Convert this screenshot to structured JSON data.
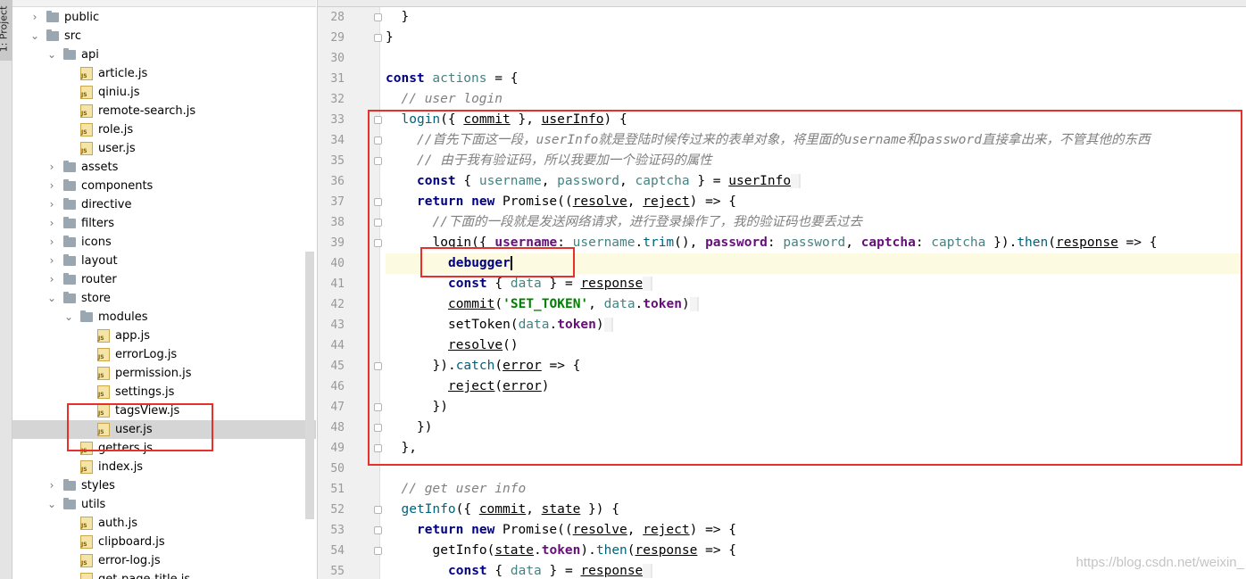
{
  "sidebar_tab": {
    "label": "1: Project"
  },
  "tree": [
    {
      "name": "public",
      "type": "folder",
      "depth": 1,
      "expanded": false
    },
    {
      "name": "src",
      "type": "folder",
      "depth": 1,
      "expanded": true
    },
    {
      "name": "api",
      "type": "folder",
      "depth": 2,
      "expanded": true
    },
    {
      "name": "article.js",
      "type": "file",
      "depth": 3
    },
    {
      "name": "qiniu.js",
      "type": "file",
      "depth": 3
    },
    {
      "name": "remote-search.js",
      "type": "file",
      "depth": 3
    },
    {
      "name": "role.js",
      "type": "file",
      "depth": 3
    },
    {
      "name": "user.js",
      "type": "file",
      "depth": 3
    },
    {
      "name": "assets",
      "type": "folder",
      "depth": 2,
      "expanded": false
    },
    {
      "name": "components",
      "type": "folder",
      "depth": 2,
      "expanded": false
    },
    {
      "name": "directive",
      "type": "folder",
      "depth": 2,
      "expanded": false
    },
    {
      "name": "filters",
      "type": "folder",
      "depth": 2,
      "expanded": false
    },
    {
      "name": "icons",
      "type": "folder",
      "depth": 2,
      "expanded": false
    },
    {
      "name": "layout",
      "type": "folder",
      "depth": 2,
      "expanded": false
    },
    {
      "name": "router",
      "type": "folder",
      "depth": 2,
      "expanded": false
    },
    {
      "name": "store",
      "type": "folder",
      "depth": 2,
      "expanded": true
    },
    {
      "name": "modules",
      "type": "folder",
      "depth": 3,
      "expanded": true
    },
    {
      "name": "app.js",
      "type": "file",
      "depth": 4
    },
    {
      "name": "errorLog.js",
      "type": "file",
      "depth": 4
    },
    {
      "name": "permission.js",
      "type": "file",
      "depth": 4
    },
    {
      "name": "settings.js",
      "type": "file",
      "depth": 4
    },
    {
      "name": "tagsView.js",
      "type": "file",
      "depth": 4
    },
    {
      "name": "user.js",
      "type": "file",
      "depth": 4,
      "selected": true
    },
    {
      "name": "getters.js",
      "type": "file",
      "depth": 3
    },
    {
      "name": "index.js",
      "type": "file",
      "depth": 3
    },
    {
      "name": "styles",
      "type": "folder",
      "depth": 2,
      "expanded": false
    },
    {
      "name": "utils",
      "type": "folder",
      "depth": 2,
      "expanded": true
    },
    {
      "name": "auth.js",
      "type": "file",
      "depth": 3
    },
    {
      "name": "clipboard.js",
      "type": "file",
      "depth": 3
    },
    {
      "name": "error-log.js",
      "type": "file",
      "depth": 3
    },
    {
      "name": "get-page-title.js",
      "type": "file",
      "depth": 3
    }
  ],
  "editor": {
    "current_line": 40,
    "lines": [
      {
        "n": "28",
        "fold": true,
        "indent": 1,
        "tokens": [
          [
            "p",
            "}"
          ]
        ]
      },
      {
        "n": "29",
        "fold": true,
        "indent": 0,
        "tokens": [
          [
            "p",
            "}"
          ]
        ]
      },
      {
        "n": "30",
        "indent": 0,
        "tokens": []
      },
      {
        "n": "31",
        "indent": 0,
        "tokens": [
          [
            "kw",
            "const"
          ],
          [
            "p",
            " "
          ],
          [
            "var",
            "actions"
          ],
          [
            "p",
            " = {"
          ]
        ]
      },
      {
        "n": "32",
        "indent": 1,
        "tokens": [
          [
            "cmt",
            "// user login"
          ]
        ]
      },
      {
        "n": "33",
        "fold": true,
        "indent": 1,
        "tokens": [
          [
            "fn",
            "login"
          ],
          [
            "p",
            "({ "
          ],
          [
            "param",
            "commit"
          ],
          [
            "p",
            " }, "
          ],
          [
            "param",
            "userInfo"
          ],
          [
            "p",
            ") {"
          ]
        ]
      },
      {
        "n": "34",
        "fold": true,
        "indent": 2,
        "tokens": [
          [
            "cmt",
            "//首先下面这一段，userInfo就是登陆时候传过来的表单对象，将里面的username和password直接拿出来，不管其他的东西"
          ]
        ]
      },
      {
        "n": "35",
        "fold": true,
        "indent": 2,
        "tokens": [
          [
            "cmt",
            "// 由于我有验证码，所以我要加一个验证码的属性"
          ]
        ]
      },
      {
        "n": "36",
        "indent": 2,
        "tokens": [
          [
            "kw",
            "const"
          ],
          [
            "p",
            " { "
          ],
          [
            "var",
            "username"
          ],
          [
            "p",
            ", "
          ],
          [
            "var",
            "password"
          ],
          [
            "p",
            ", "
          ],
          [
            "var",
            "captcha"
          ],
          [
            "p",
            " } = "
          ],
          [
            "param",
            "userInfo"
          ],
          [
            "hl",
            ""
          ]
        ]
      },
      {
        "n": "37",
        "fold": true,
        "indent": 2,
        "tokens": [
          [
            "kw",
            "return"
          ],
          [
            "p",
            " "
          ],
          [
            "kw",
            "new"
          ],
          [
            "p",
            " Promise(("
          ],
          [
            "param",
            "resolve"
          ],
          [
            "p",
            ", "
          ],
          [
            "param",
            "reject"
          ],
          [
            "p",
            ") => {"
          ]
        ]
      },
      {
        "n": "38",
        "fold": true,
        "indent": 3,
        "tokens": [
          [
            "cmt",
            "//下面的一段就是发送网络请求，进行登录操作了，我的验证码也要丢过去"
          ]
        ]
      },
      {
        "n": "39",
        "fold": true,
        "indent": 3,
        "tokens": [
          [
            "p",
            "login({ "
          ],
          [
            "prop",
            "username"
          ],
          [
            "p",
            ": "
          ],
          [
            "var",
            "username"
          ],
          [
            "p",
            "."
          ],
          [
            "fn",
            "trim"
          ],
          [
            "p",
            "(), "
          ],
          [
            "prop",
            "password"
          ],
          [
            "p",
            ": "
          ],
          [
            "var",
            "password"
          ],
          [
            "p",
            ", "
          ],
          [
            "prop",
            "captcha"
          ],
          [
            "p",
            ": "
          ],
          [
            "var",
            "captcha"
          ],
          [
            "p",
            " })."
          ],
          [
            "fn",
            "then"
          ],
          [
            "p",
            "("
          ],
          [
            "param",
            "response"
          ],
          [
            "p",
            " => {"
          ]
        ]
      },
      {
        "n": "40",
        "indent": 4,
        "tokens": [
          [
            "kw",
            "debugger"
          ],
          [
            "caret",
            ""
          ]
        ]
      },
      {
        "n": "41",
        "indent": 4,
        "tokens": [
          [
            "kw",
            "const"
          ],
          [
            "p",
            " { "
          ],
          [
            "var",
            "data"
          ],
          [
            "p",
            " } = "
          ],
          [
            "param",
            "response"
          ],
          [
            "hl",
            ""
          ]
        ]
      },
      {
        "n": "42",
        "indent": 4,
        "tokens": [
          [
            "ul",
            "commit"
          ],
          [
            "p",
            "("
          ],
          [
            "str",
            "'SET_TOKEN'"
          ],
          [
            "p",
            ", "
          ],
          [
            "var",
            "data"
          ],
          [
            "p",
            "."
          ],
          [
            "prop",
            "token"
          ],
          [
            "p",
            ")"
          ],
          [
            "hl",
            ""
          ]
        ]
      },
      {
        "n": "43",
        "indent": 4,
        "tokens": [
          [
            "p",
            "setToken("
          ],
          [
            "var",
            "data"
          ],
          [
            "p",
            "."
          ],
          [
            "prop",
            "token"
          ],
          [
            "p",
            ")"
          ],
          [
            "hl",
            ""
          ]
        ]
      },
      {
        "n": "44",
        "indent": 4,
        "tokens": [
          [
            "ul",
            "resolve"
          ],
          [
            "p",
            "()"
          ]
        ]
      },
      {
        "n": "45",
        "fold": true,
        "indent": 3,
        "tokens": [
          [
            "p",
            "})."
          ],
          [
            "fn",
            "catch"
          ],
          [
            "p",
            "("
          ],
          [
            "param",
            "error"
          ],
          [
            "p",
            " => {"
          ]
        ]
      },
      {
        "n": "46",
        "indent": 4,
        "tokens": [
          [
            "ul",
            "reject"
          ],
          [
            "p",
            "("
          ],
          [
            "param",
            "error"
          ],
          [
            "p",
            ")"
          ]
        ]
      },
      {
        "n": "47",
        "fold": true,
        "indent": 3,
        "tokens": [
          [
            "p",
            "})"
          ]
        ]
      },
      {
        "n": "48",
        "fold": true,
        "indent": 2,
        "tokens": [
          [
            "p",
            "})"
          ]
        ]
      },
      {
        "n": "49",
        "fold": true,
        "indent": 1,
        "tokens": [
          [
            "p",
            "},"
          ]
        ]
      },
      {
        "n": "50",
        "indent": 0,
        "tokens": []
      },
      {
        "n": "51",
        "indent": 1,
        "tokens": [
          [
            "cmt",
            "// get user info"
          ]
        ]
      },
      {
        "n": "52",
        "fold": true,
        "indent": 1,
        "tokens": [
          [
            "fn",
            "getInfo"
          ],
          [
            "p",
            "({ "
          ],
          [
            "param",
            "commit"
          ],
          [
            "p",
            ", "
          ],
          [
            "param",
            "state"
          ],
          [
            "p",
            " }) {"
          ]
        ]
      },
      {
        "n": "53",
        "fold": true,
        "indent": 2,
        "tokens": [
          [
            "kw",
            "return"
          ],
          [
            "p",
            " "
          ],
          [
            "kw",
            "new"
          ],
          [
            "p",
            " Promise(("
          ],
          [
            "param",
            "resolve"
          ],
          [
            "p",
            ", "
          ],
          [
            "param",
            "reject"
          ],
          [
            "p",
            ") => {"
          ]
        ]
      },
      {
        "n": "54",
        "fold": true,
        "indent": 3,
        "tokens": [
          [
            "p",
            "getInfo("
          ],
          [
            "param",
            "state"
          ],
          [
            "p",
            "."
          ],
          [
            "prop",
            "token"
          ],
          [
            "p",
            ")."
          ],
          [
            "fn",
            "then"
          ],
          [
            "p",
            "("
          ],
          [
            "param",
            "response"
          ],
          [
            "p",
            " => {"
          ]
        ]
      },
      {
        "n": "55",
        "indent": 4,
        "tokens": [
          [
            "kw",
            "const"
          ],
          [
            "p",
            " { "
          ],
          [
            "var",
            "data"
          ],
          [
            "p",
            " } = "
          ],
          [
            "param",
            "response"
          ],
          [
            "hl",
            ""
          ]
        ]
      }
    ]
  },
  "watermark": "https://blog.csdn.net/weixin_",
  "colors": {
    "annotation_box": "#e8302b",
    "current_line": "#fcfae0"
  }
}
